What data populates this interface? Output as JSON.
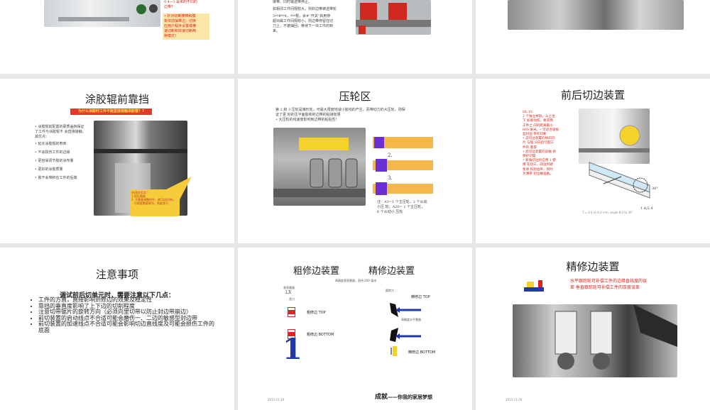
{
  "s1": {
    "callout_lines": [
      "0.4~3 毫米的不同的",
      "边带？"
    ],
    "note_lines": [
      "• 针对切断横带和膜",
      "条体前抽带边，切换",
      "应用户程序设置或横",
      "速切断和快速切断两",
      "种模式！"
    ]
  },
  "s2": {
    "lines": [
      "接带。同时输送带停止。",
      "如相邻工件间隔较大，则封边带被送带轮",
      "5ºº#ºº4，ººº根，会#“开关”启用停",
      "超出磁工件间隔较小，则边带停留在切",
      "刀上，不被抽回，等待下一块工件的到",
      "来。"
    ]
  },
  "s4": {
    "title": "涂胶辊前靠挡",
    "banner": "为什么涂胶时工件不能直接接触涂胶辊？?",
    "bullets": [
      "• 涂胶辊前配置的硬质盖挡保证了工件与涂胶辊不 会直接接触，其优点：",
      "• 延长涂胶辊的寿命",
      "• 不会损伤工件的边缘",
      "• 更容易调节胶的涂布量",
      "• 更好的涂胶质量",
      "• 胶不会堆积在工件的后端"
    ],
    "callout": [
      "份(图)(优点:",
      "1.保证精度",
      "2. 不需要调整控件，就可适应特殊",
      "...可根据需要调节，角度多为"
    ]
  },
  "s5": {
    "title": "压轮区",
    "intro": [
      "第 2 和 3 压轮是锥形轮，可最大限度地减小胶线的产生，而带动力的大压轮，则保",
      "证了更 好的压平面胶和封边带的粘接效果",
      "• 大压轮的线速度影响到边带的粘贴性！"
    ],
    "labels": [
      "2.",
      "3."
    ],
    "note": [
      "注：A3=1 个主压轮，2 个从动",
      "小压 轮；A20= 1  个主压轮，",
      "6 个从动小 压轮"
    ]
  },
  "s6": {
    "title": "前后切边装置",
    "left_lines": [
      "HL 01",
      "2 个独立导轨，从上往",
      "下  如果动作。要求两",
      "工件之 间的距离最小",
      "600 毫米。• 可适合吸振",
      "型封边 带的切断",
      "• 前切边装置的倾斜刀",
      "片 与锯 分向后切超工",
      "件的 底部",
      "• 后切边装置的斜磁  修",
      "保护切锯",
      "• 新角切边的应用 1 使",
      "用 在封三，四边时避",
      "免修 扣封边带，同时",
      "为薄带 封边做准备。"
    ],
    "angle": "30°",
    "code": "1.4/2.4",
    "caption": "T = 0.4 to 4.0 mm, angle 8.0 to 30°"
  },
  "s7": {
    "title": "注意事项",
    "subtitle": "调试前后切单元时，需要注意以下几点：",
    "bullets": [
      "工件的方直，直接影响到修边的效果及稳定性",
      "靠挡的垂直度影响了上下边的切削程度",
      "注意切带锯片的旋转方向（必须向里切带以防止封边带崩边）",
      "前切装置的启动线点不合适可能会磨伤一、二边的敏感型封边带",
      "前切装置的加速线点不合适可能会影响切边直线度及可能会损伤工件的底面"
    ]
  },
  "s8": {
    "title_left": "粗修边装置",
    "title_right": "精修边装置",
    "subtitle": "高精度垂直靠器，直径 200 毫米",
    "left_top": "垂直靠器",
    "lx": "LX",
    "lx_sub": "直刀",
    "rough_top": "粗修边 TOP",
    "rough_bottom": "粗修边 BOTTOM",
    "big_number": "1",
    "fine_head": "跟踪刀",
    "fine_top": "精修边 TOP",
    "fine_mid": "高精度水平靠器",
    "fine_bottom": "精修边 BOTTOM",
    "footer": "成就——你我的家居梦想",
    "footer_bold": "成就",
    "footer_rest": "——你我的家居梦想",
    "date": "2013-11-26"
  },
  "s9": {
    "title": "精修边装置",
    "desc": [
      "水平跟踪轮可补偿工件的边缘直线度的误",
      "差 垂直跟踪轮可补偿工件的厚度误差"
    ],
    "date": "2013-11-26"
  },
  "colors": {
    "accent_red": "#d9251c",
    "banner_red": "#e23a2a",
    "yellow": "#f5d229",
    "orange": "#f4b84a",
    "purple": "#6b2fd6",
    "blue": "#1f3aa8"
  }
}
